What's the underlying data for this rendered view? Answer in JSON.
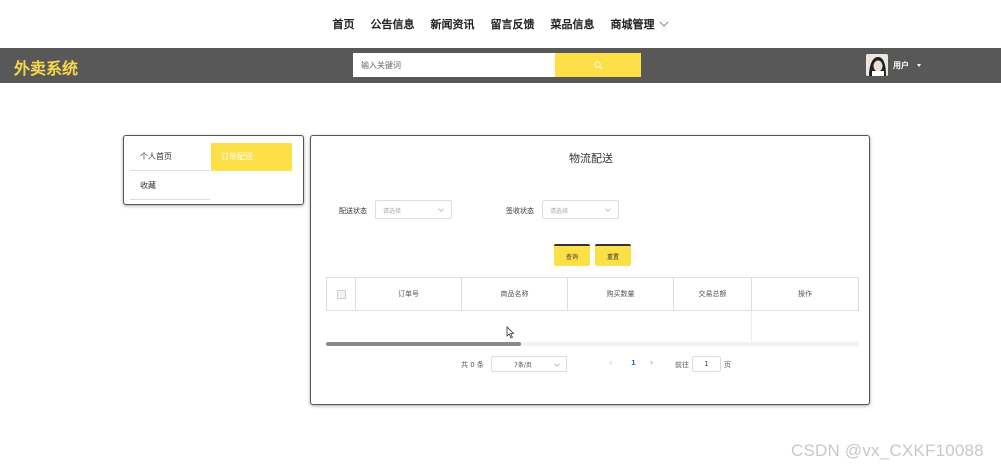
{
  "top_nav": {
    "items": [
      "首页",
      "公告信息",
      "新闻资讯",
      "留言反馈",
      "菜品信息",
      "商城管理"
    ]
  },
  "header": {
    "brand": "外卖系统",
    "search_placeholder": "输入关键词",
    "user_label": "用户",
    "colors": {
      "bar": "#585858",
      "accent": "#fde047",
      "brand_text": "#f6d94b"
    }
  },
  "side_menu": {
    "items": [
      "个人首页",
      "订单配送",
      "收藏"
    ],
    "active": "订单配送"
  },
  "main": {
    "title": "物流配送",
    "filters": {
      "delivery_status_label": "配送状态",
      "delivery_status_placeholder": "请选择",
      "sign_status_label": "签收状态",
      "sign_status_placeholder": "请选择"
    },
    "buttons": {
      "query": "查询",
      "reset": "重置"
    },
    "table": {
      "columns": [
        "订单号",
        "商品名称",
        "购买数量",
        "交易总额",
        "操作"
      ],
      "rows": []
    },
    "pagination": {
      "total_text": "共 0 条",
      "page_size": "7条/页",
      "current_page": "1",
      "goto_label": "前往",
      "goto_value": "1",
      "page_unit": "页"
    }
  },
  "watermark": "CSDN @vx_CXKF10088"
}
